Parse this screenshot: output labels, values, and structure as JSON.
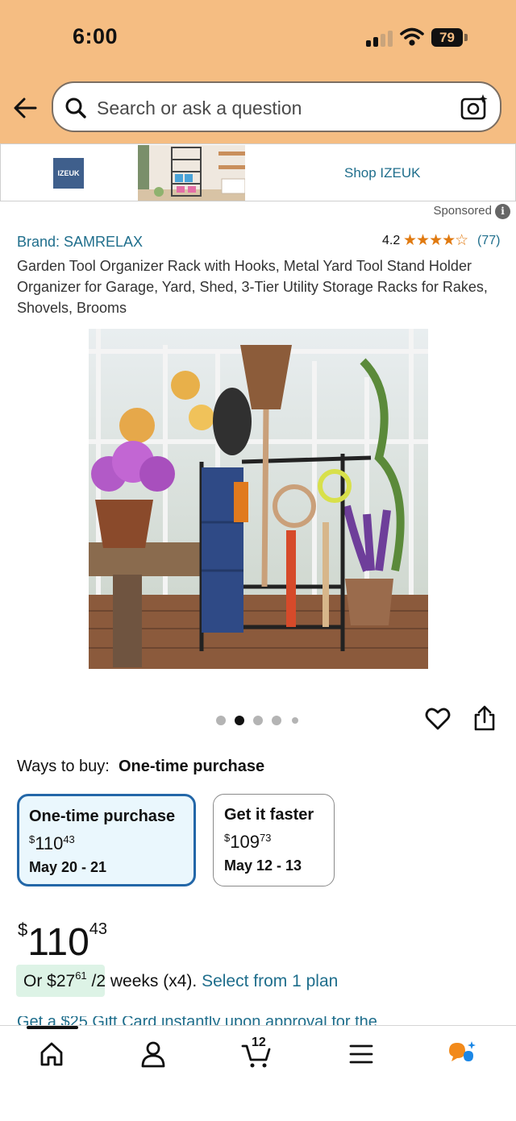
{
  "status_bar": {
    "time": "6:00",
    "battery": "79"
  },
  "search": {
    "placeholder": "Search or ask a question"
  },
  "sponsored_banner": {
    "logo_text": "IZEUK",
    "link": "Shop IZEUK",
    "sponsored_label": "Sponsored"
  },
  "product": {
    "brand": "Brand: SAMRELAX",
    "rating": "4.2",
    "stars": "★★★★☆",
    "rating_value": 4.2,
    "rating_count": "(77)",
    "title": "Garden Tool Organizer Rack with Hooks, Metal Yard Tool Stand Holder Organizer for Garage, Yard, Shed, 3-Tier Utility Storage Racks for Rakes, Shovels, Brooms",
    "image_count": 5,
    "active_image_index": 1
  },
  "ways_to_buy": {
    "label": "Ways to buy:",
    "selected": "One-time purchase",
    "options": [
      {
        "title": "One-time purchase",
        "currency": "$",
        "price_whole": "110",
        "price_cents": "43",
        "date": "May 20 - 21"
      },
      {
        "title": "Get it faster",
        "currency": "$",
        "price_whole": "109",
        "price_cents": "73",
        "date": "May 12 - 13"
      }
    ]
  },
  "price": {
    "currency": "$",
    "whole": "110",
    "cents": "43"
  },
  "installment": {
    "prefix": "Or $",
    "whole": "27",
    "cents": "61",
    "suffix": "/2 weeks (x4).",
    "link": "Select from 1 plan"
  },
  "promo_partial": "Get a $25 Gift Card instantly upon approval for the",
  "bottom_nav": {
    "cart_count": "12"
  },
  "colors": {
    "header_bg": "#f5bd82",
    "link": "#1f6e8c",
    "star": "#e07a10",
    "selected_border": "#2367a8",
    "selected_bg": "#eaf7fd",
    "installment_bg": "#ddf3e6"
  }
}
